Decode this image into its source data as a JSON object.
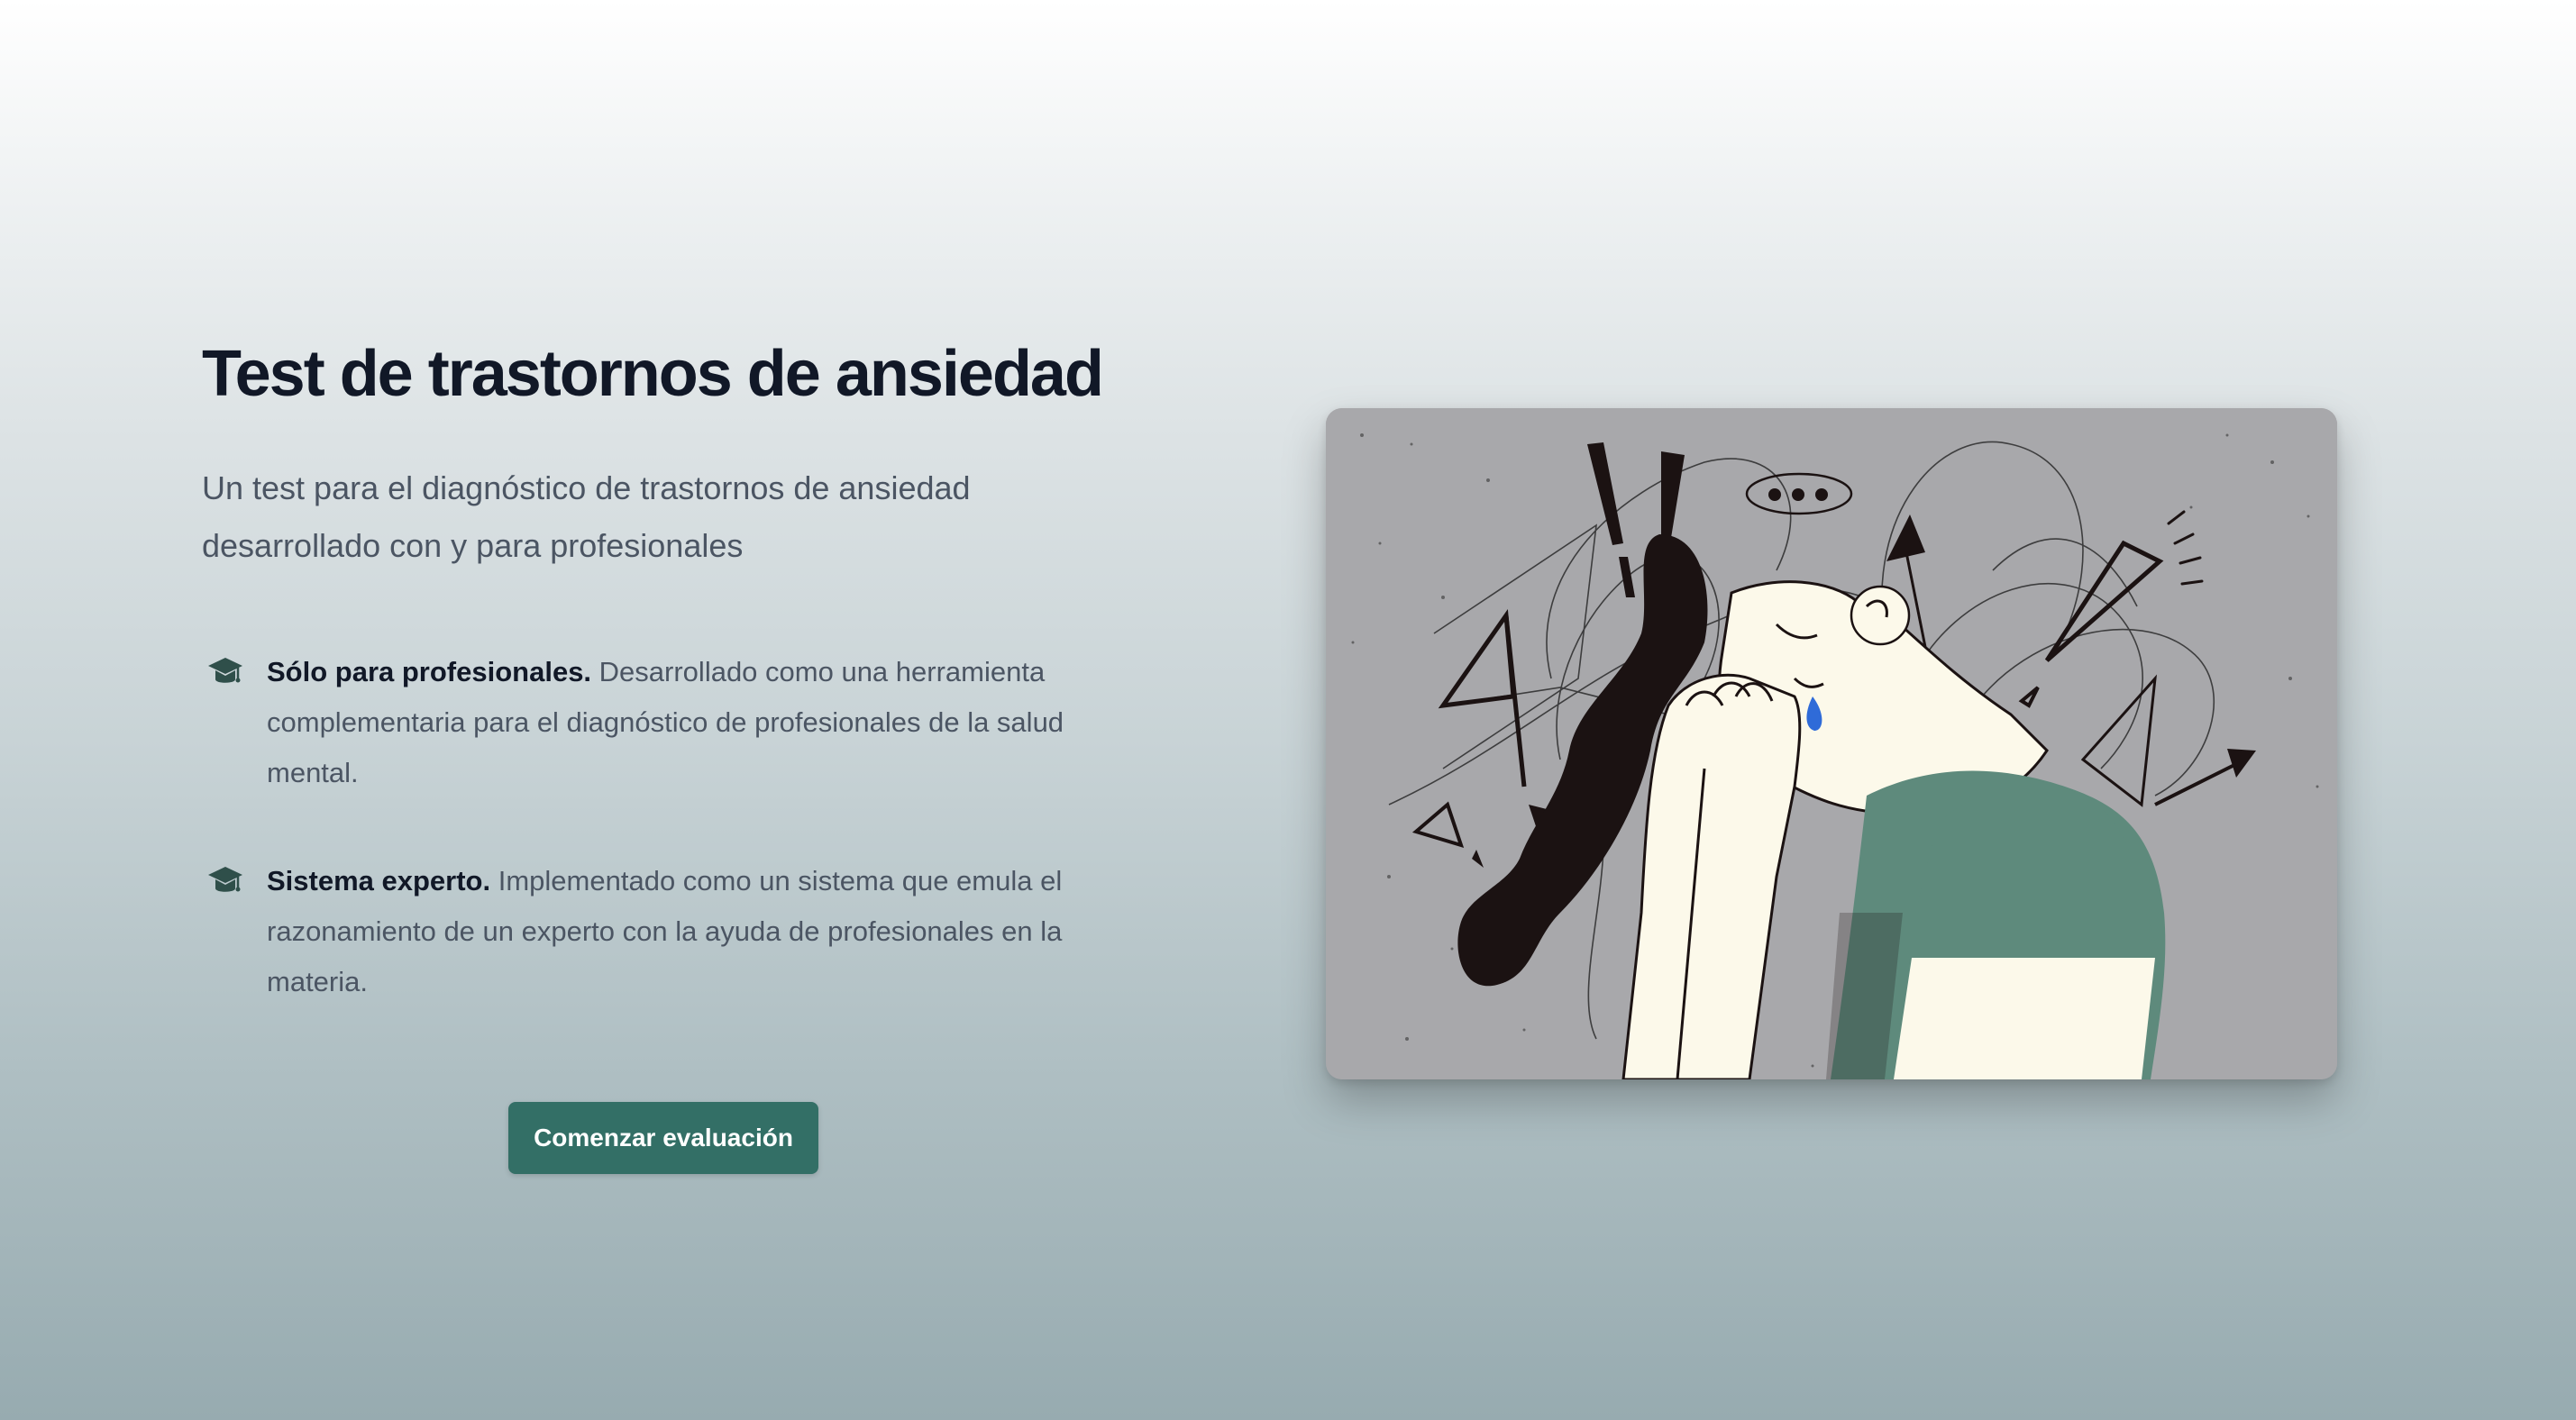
{
  "hero": {
    "title": "Test de trastornos de ansiedad",
    "subtitle": "Un test para el diagnóstico de trastornos de ansiedad desarrollado con y para profesionales",
    "features": [
      {
        "icon": "graduation-cap-icon",
        "title": "Sólo para profesionales.",
        "description": "Desarrollado como una herramienta complementaria para el diagnóstico de profesionales de la salud mental."
      },
      {
        "icon": "graduation-cap-icon",
        "title": "Sistema experto.",
        "description": "Implementado como un sistema que emula el razonamiento de un experto con la ayuda de profesionales en la materia."
      }
    ],
    "cta_label": "Comenzar evaluación"
  },
  "colors": {
    "accent": "#336f66",
    "title_text": "#111827",
    "body_text": "#4b5563",
    "illustration_bg": "#a8a8ab",
    "illustration_green": "#5e8a7c",
    "illustration_cream": "#fcf9ea",
    "illustration_dark": "#1b1212",
    "tear": "#2f6bd8"
  }
}
